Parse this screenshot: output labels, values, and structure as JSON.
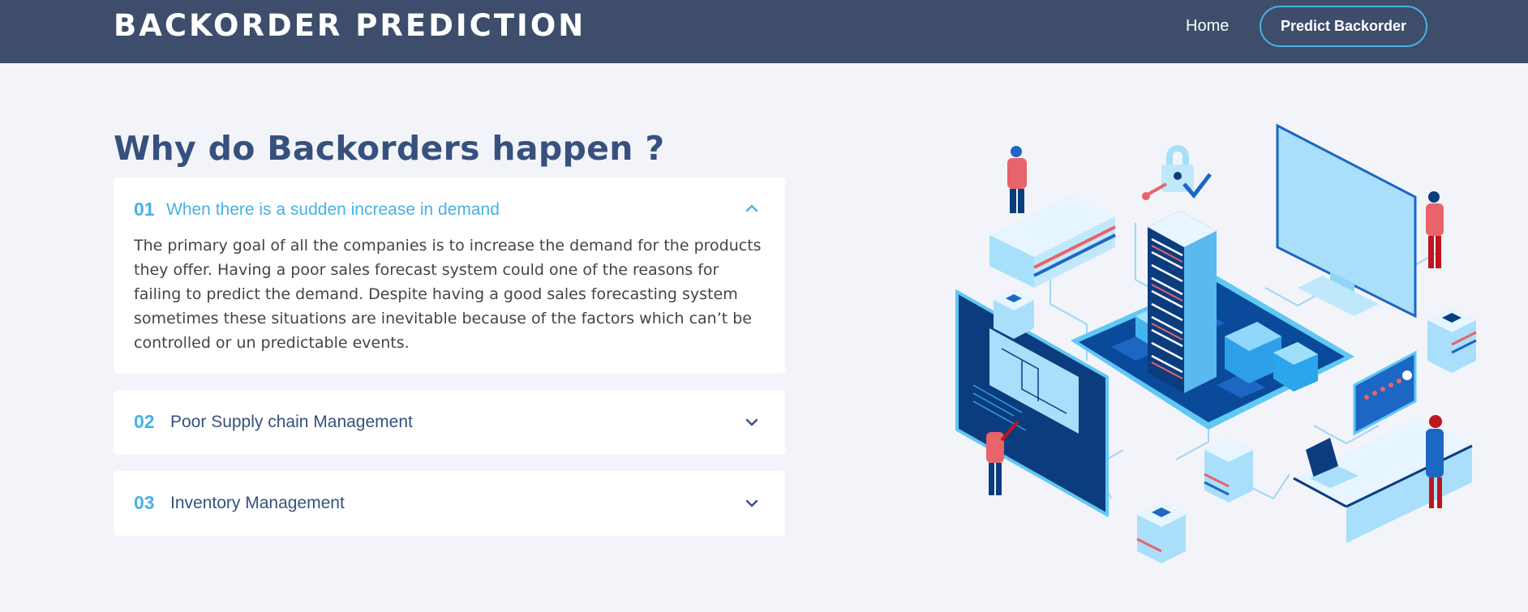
{
  "header": {
    "logo": "BACKORDER PREDICTION",
    "nav": {
      "home": "Home",
      "cta": "Predict Backorder"
    }
  },
  "faq": {
    "title": "Why do Backorders happen ?",
    "items": [
      {
        "number": "01",
        "question": "When there is a sudden increase in demand",
        "expanded": true,
        "answer": "The primary goal of all the companies is to increase the demand for the products they offer. Having a poor sales forecast system could one of the reasons for failing to predict the demand. Despite having a good sales forecasting system sometimes these situations are inevitable because of the factors which can’t be controlled or un predictable events."
      },
      {
        "number": "02",
        "question": "Poor Supply chain Management",
        "expanded": false
      },
      {
        "number": "03",
        "question": "Inventory Management",
        "expanded": false
      }
    ]
  },
  "colors": {
    "header_bg": "#3d4d6b",
    "accent": "#47b2e4",
    "heading": "#37517e",
    "page_bg": "#f3f4f9"
  },
  "icons": {
    "collapse": "chevron-up-icon",
    "expand": "chevron-down-icon"
  }
}
